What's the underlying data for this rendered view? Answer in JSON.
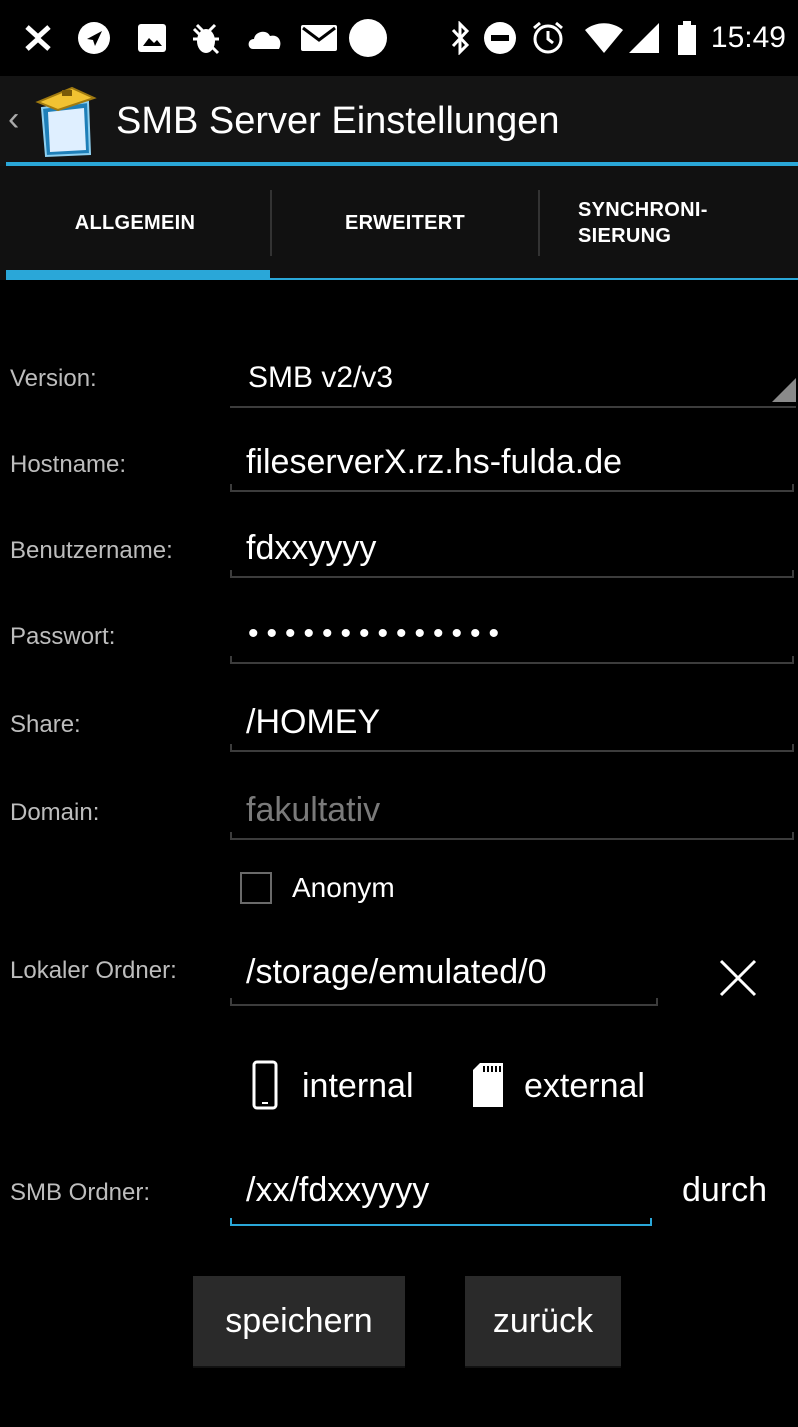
{
  "status_bar": {
    "time": "15:49",
    "icons_left": [
      "usb-icon",
      "navigation-icon",
      "image-icon",
      "debug-icon",
      "cloud-icon",
      "mail-icon",
      "record-icon"
    ],
    "icons_right": [
      "bluetooth-icon",
      "do-not-disturb-icon",
      "alarm-icon",
      "wifi-icon",
      "signal-icon",
      "battery-icon"
    ]
  },
  "action_bar": {
    "title": "SMB Server Einstellungen",
    "back_glyph": "‹"
  },
  "tabs": [
    {
      "label": "ALLGEMEIN",
      "active": true
    },
    {
      "label": "ERWEITERT",
      "active": false
    },
    {
      "label": "SYNCHRONI-\nSIERUNG",
      "active": false
    }
  ],
  "tab_labels": {
    "t0": "ALLGEMEIN",
    "t1": "ERWEITERT",
    "t2_line1": "SYNCHRONI-",
    "t2_line2": "SIERUNG"
  },
  "form": {
    "version": {
      "label": "Version:",
      "value": "SMB v2/v3"
    },
    "hostname": {
      "label": "Hostname:",
      "value": "fileserverX.rz.hs-fulda.de"
    },
    "username": {
      "label": "Benutzername:",
      "value": "fdxxyyyy"
    },
    "password": {
      "label": "Passwort:",
      "value": "••••••••••••••"
    },
    "share": {
      "label": "Share:",
      "value": "/HOMEY"
    },
    "domain": {
      "label": "Domain:",
      "placeholder": "fakultativ"
    },
    "anonym": {
      "label": "Anonym",
      "checked": false
    },
    "local_folder": {
      "label": "Lokaler Ordner:",
      "value": "/storage/emulated/0",
      "clear_glyph": "✕"
    },
    "storage": {
      "internal_label": "internal",
      "external_label": "external"
    },
    "smb_folder": {
      "label": "SMB Ordner:",
      "value": "/xx/fdxxyyyy",
      "browse_label": "durch"
    }
  },
  "buttons": {
    "save": "speichern",
    "back": "zurück"
  },
  "colors": {
    "accent": "#2aa7d8",
    "background": "#000000",
    "label": "#bdbdbd",
    "hint": "#7a7a7a"
  }
}
